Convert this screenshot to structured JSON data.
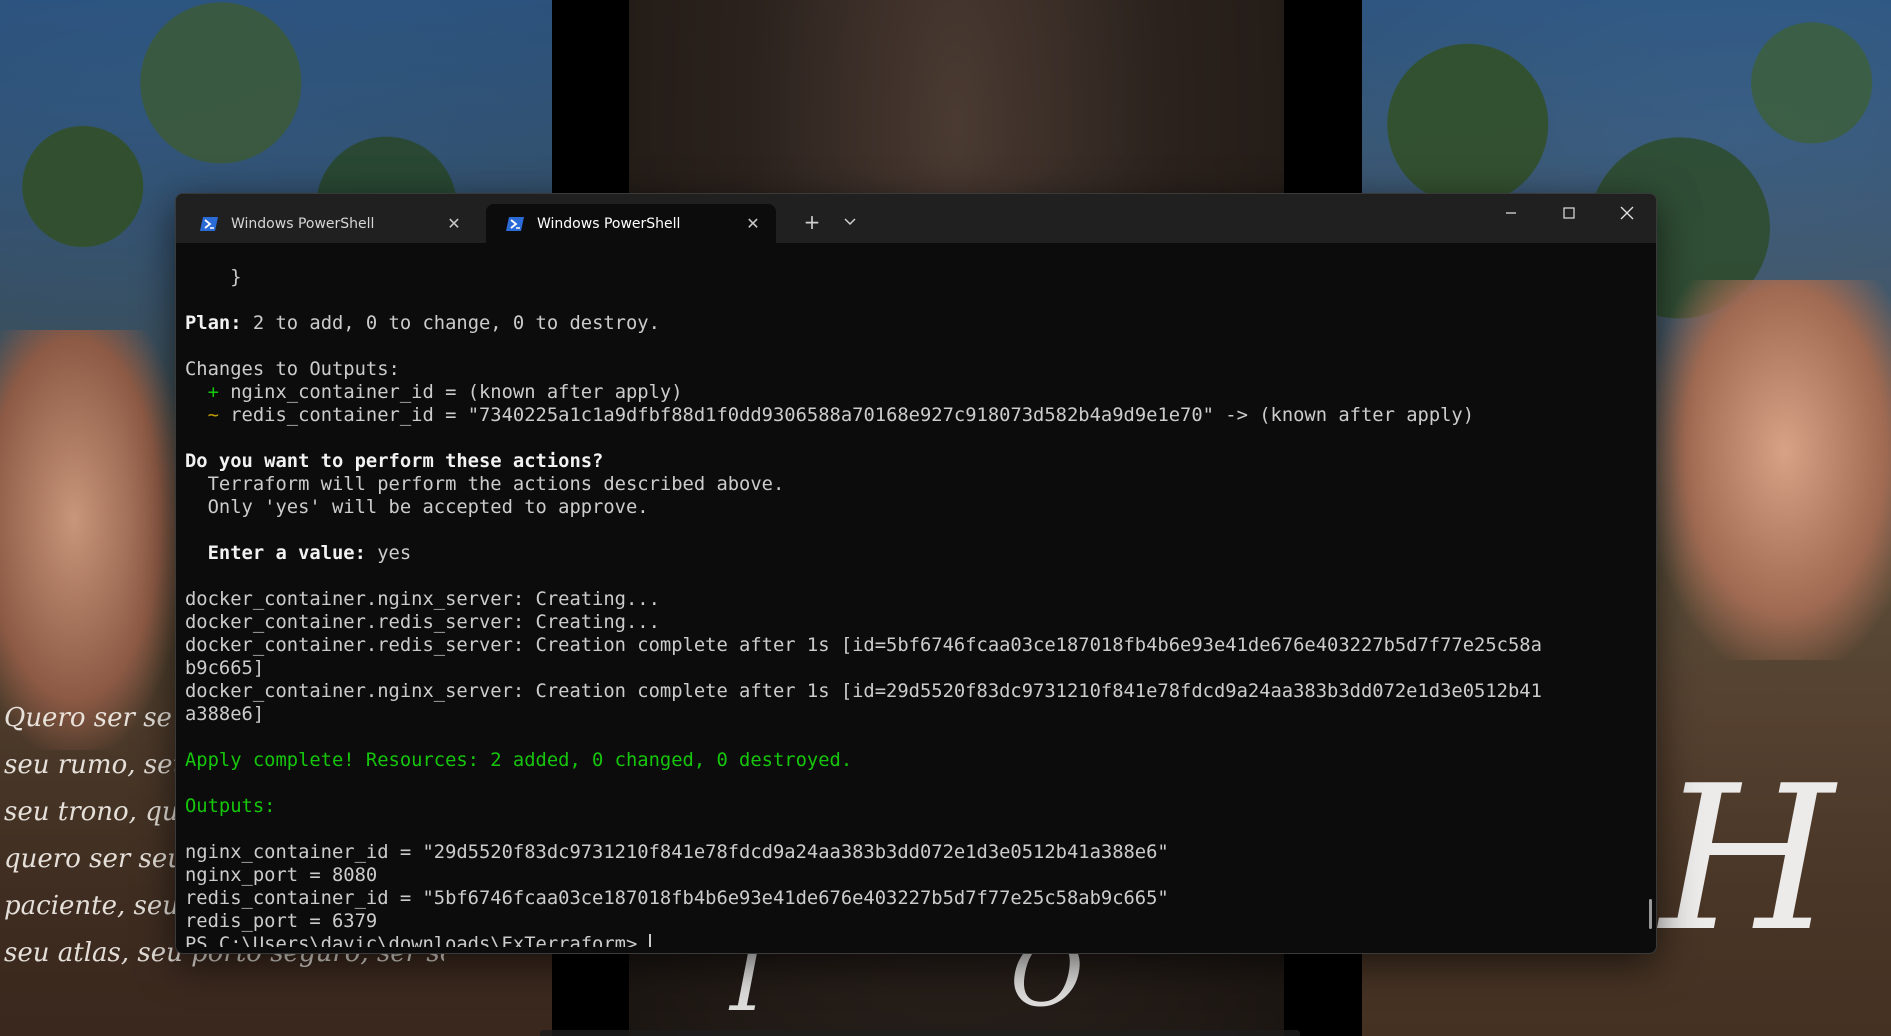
{
  "wallpaper": {
    "script_lines": [
      "Quero ser se",
      "seu rumo, seu a",
      "seu trono, que",
      "quero ser seu",
      "paciente, seu d",
      "seu atlas, seu porto seguro, ser seu fã"
    ],
    "monogram_h": "H",
    "monogram_o": "O",
    "monogram_i": "I"
  },
  "terminal": {
    "tabs": [
      {
        "label": "Windows PowerShell",
        "active": false,
        "icon": "powershell-icon"
      },
      {
        "label": "Windows PowerShell",
        "active": true,
        "icon": "powershell-icon"
      }
    ],
    "new_tab_glyph": "+",
    "dropdown_glyph": "⌄",
    "window_controls": {
      "minimize": "—",
      "maximize": "☐",
      "close": "✕"
    },
    "lines": {
      "l01": "    }",
      "l02_label": "Plan:",
      "l02_rest": " 2 to add, 0 to change, 0 to destroy.",
      "l03": "Changes to Outputs:",
      "l04_sym": "+",
      "l04_rest": " nginx_container_id = (known after apply)",
      "l05_sym": "~",
      "l05_rest": " redis_container_id = \"7340225a1c1a9dfbf88d1f0dd9306588a70168e927c918073d582b4a9d9e1e70\" -> (known after apply)",
      "l06": "Do you want to perform these actions?",
      "l07": "  Terraform will perform the actions described above.",
      "l08": "  Only 'yes' will be accepted to approve.",
      "l09_label": "  Enter a value:",
      "l09_value": " yes",
      "l10": "docker_container.nginx_server: Creating...",
      "l11": "docker_container.redis_server: Creating...",
      "l12": "docker_container.redis_server: Creation complete after 1s [id=5bf6746fcaa03ce187018fb4b6e93e41de676e403227b5d7f77e25c58a",
      "l13": "b9c665]",
      "l14": "docker_container.nginx_server: Creation complete after 1s [id=29d5520f83dc9731210f841e78fdcd9a24aa383b3dd072e1d3e0512b41",
      "l15": "a388e6]",
      "l16": "Apply complete! Resources: 2 added, 0 changed, 0 destroyed.",
      "l17": "Outputs:",
      "l18": "nginx_container_id = \"29d5520f83dc9731210f841e78fdcd9a24aa383b3dd072e1d3e0512b41a388e6\"",
      "l19": "nginx_port = 8080",
      "l20": "redis_container_id = \"5bf6746fcaa03ce187018fb4b6e93e41de676e403227b5d7f77e25c58ab9c665\"",
      "l21": "redis_port = 6379",
      "prompt": "PS C:\\Users\\davic\\downloads\\ExTerraform> "
    },
    "colors": {
      "background": "#0c0c0c",
      "titlebar": "#202020",
      "text": "#cccccc",
      "success_green": "#16c60c",
      "change_yellow": "#c19c00"
    }
  }
}
